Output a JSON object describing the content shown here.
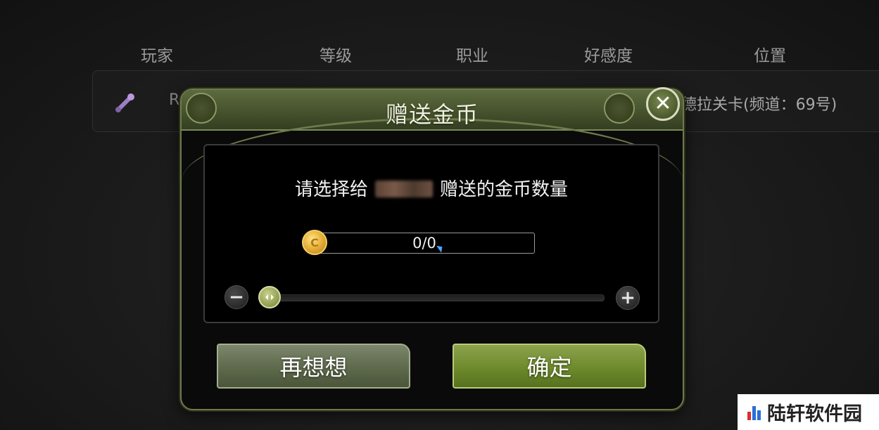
{
  "table": {
    "headers": {
      "player": "玩家",
      "level": "等级",
      "class": "职业",
      "favor": "好感度",
      "location": "位置"
    },
    "row": {
      "name_fragment": "R",
      "location": "德拉关卡(频道：69号)"
    }
  },
  "dialog": {
    "title": "赠送金币",
    "close_glyph": "✕",
    "prompt_prefix": "请选择给",
    "prompt_suffix": "赠送的金币数量",
    "amount": "0/0",
    "minus_glyph": "−",
    "plus_glyph": "+",
    "cancel_label": "再想想",
    "confirm_label": "确定"
  },
  "watermark": {
    "text": "陆轩软件园"
  },
  "colors": {
    "dialog_frame": "#6e7a4c",
    "title_bar": "#46532d",
    "confirm_button": "#6e8a2c",
    "cancel_button": "#5e6a4b",
    "coin": "#e9b33c"
  },
  "icons": {
    "row_icon": "sword-icon",
    "coin": "gold-coin-icon",
    "close": "close-icon"
  }
}
